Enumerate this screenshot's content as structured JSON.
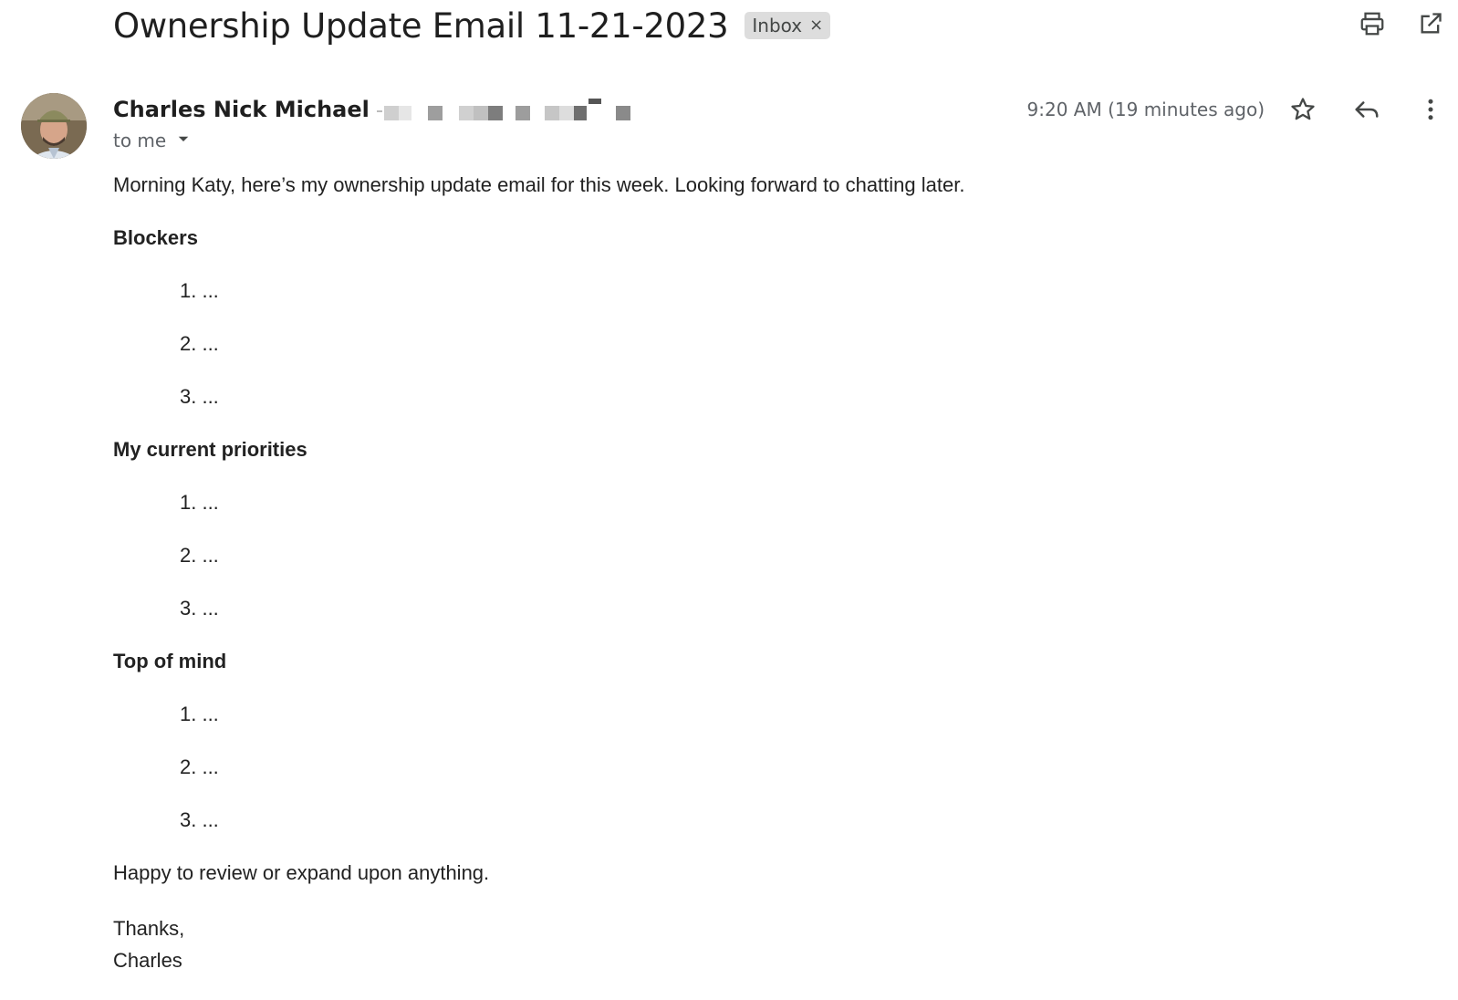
{
  "header": {
    "subject": "Ownership Update Email 11-21-2023",
    "label": "Inbox",
    "label_remove": "×",
    "actions": [
      {
        "name": "print-icon"
      },
      {
        "name": "open-in-new-window-icon"
      }
    ]
  },
  "sender": {
    "name": "Charles Nick Michael",
    "email_redacted": true,
    "recipient_text": "to me",
    "timestamp": "9:20 AM (19 minutes ago)",
    "actions": [
      {
        "name": "star-icon"
      },
      {
        "name": "reply-icon"
      },
      {
        "name": "more-options-icon"
      }
    ]
  },
  "body": {
    "greeting": "Morning Katy, here’s my ownership update email for this week. Looking forward to chatting later.",
    "sections": [
      {
        "heading": "Blockers",
        "items": [
          "1. ...",
          "2. ...",
          "3. ..."
        ]
      },
      {
        "heading": "My current priorities",
        "items": [
          "1. ...",
          "2. ...",
          "3. ..."
        ]
      },
      {
        "heading": "Top of mind",
        "items": [
          "1. ...",
          "2. ...",
          "3. ..."
        ]
      }
    ],
    "closing_line": "Happy to review or expand upon anything.",
    "signoff": "Thanks,",
    "signature": "Charles"
  },
  "colors": {
    "chip_bg": "#dddddd",
    "text_primary": "#1f1f1f",
    "text_secondary": "#5f6368",
    "icon": "#444746"
  }
}
